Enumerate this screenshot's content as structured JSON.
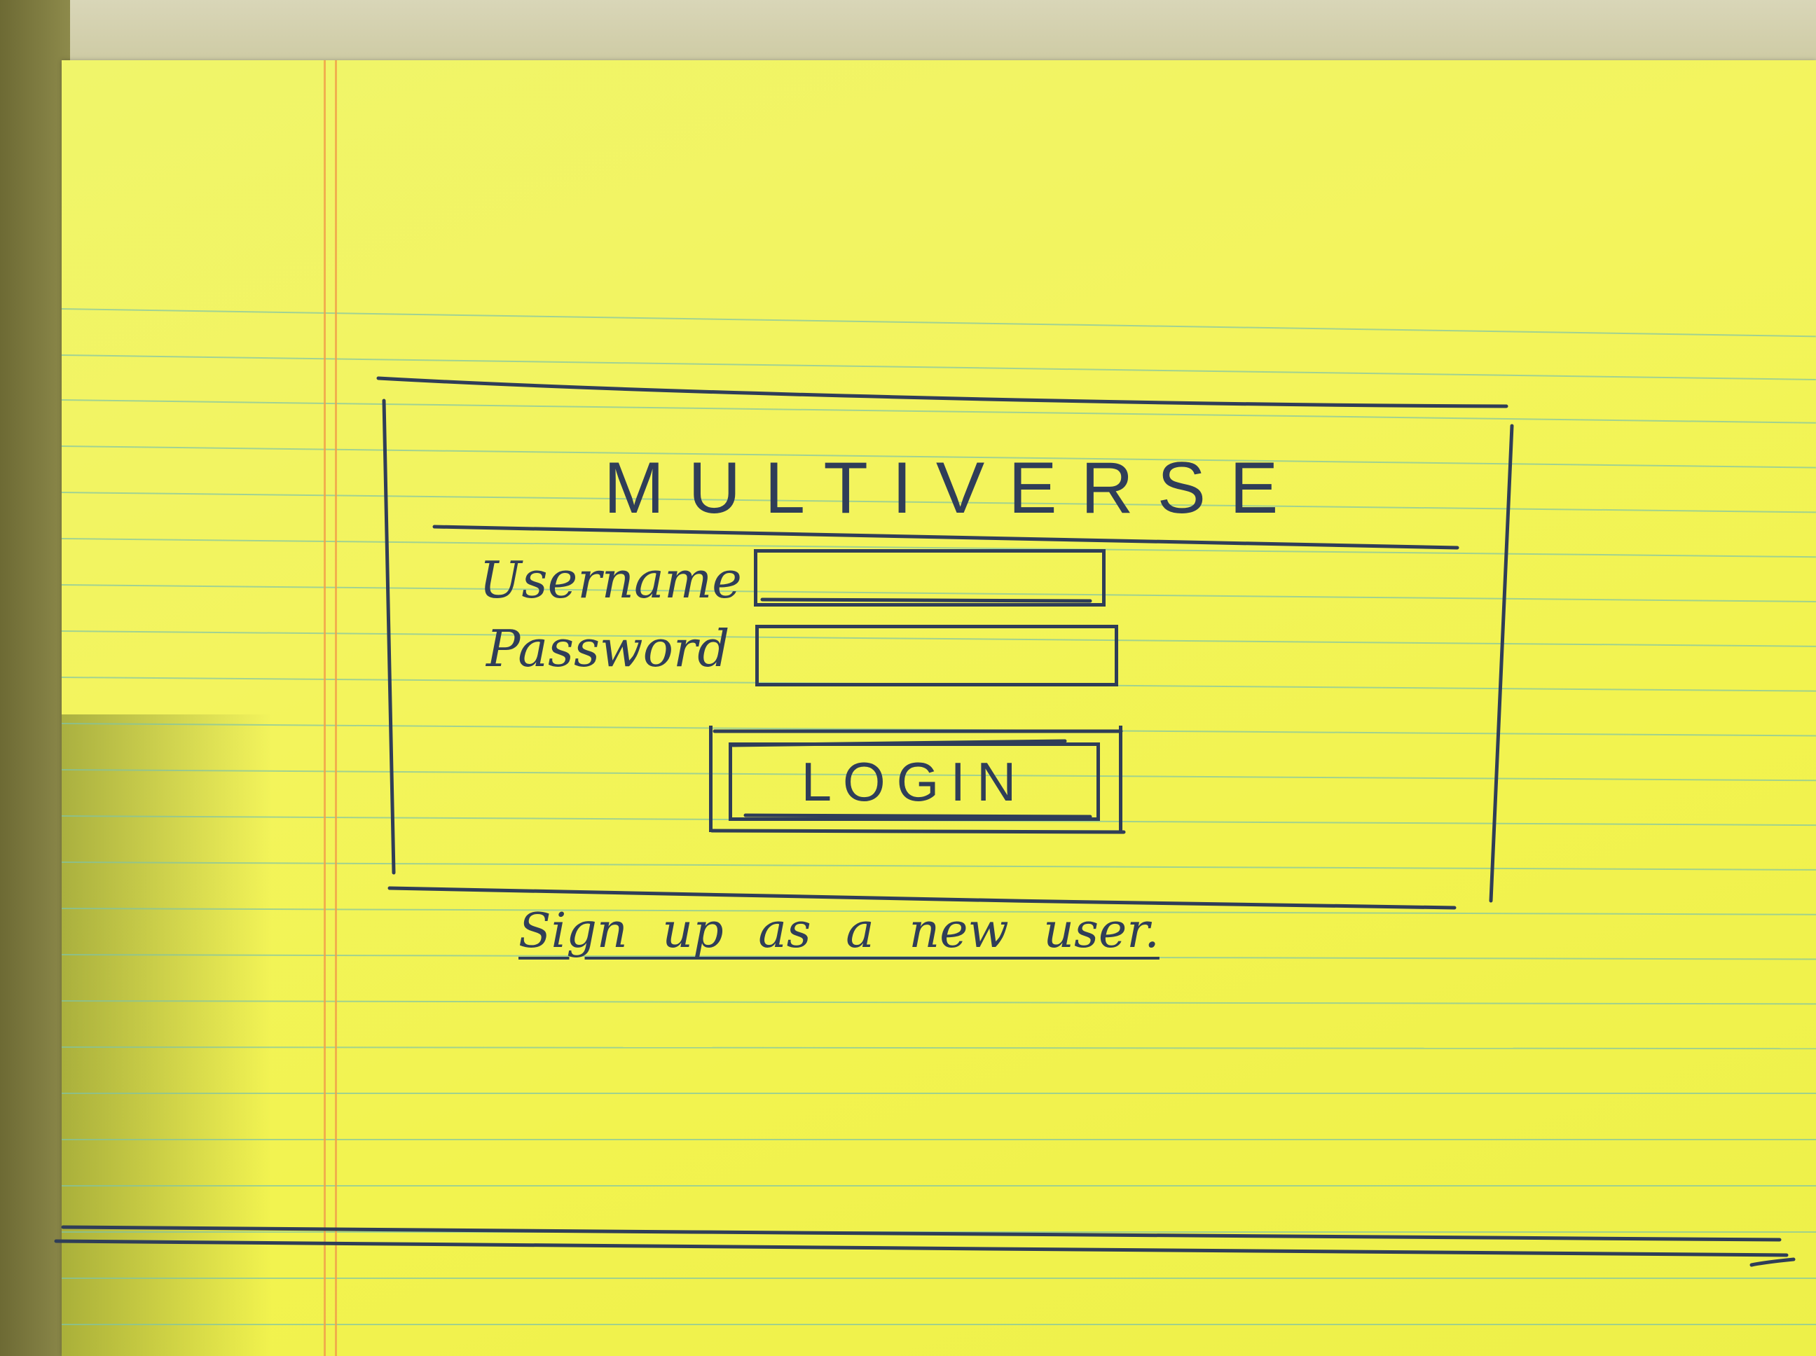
{
  "title": "MULTIVERSE",
  "form": {
    "username_label": "Username",
    "password_label": "Password",
    "username_value": "",
    "password_value": "",
    "login_label": "LOGIN"
  },
  "signup_link": "Sign up as a new user.",
  "colors": {
    "paper": "#f2f34f",
    "ink": "#2f3d58",
    "rule_line": "#7ec3a8",
    "margin_line": "#f1a24a"
  }
}
